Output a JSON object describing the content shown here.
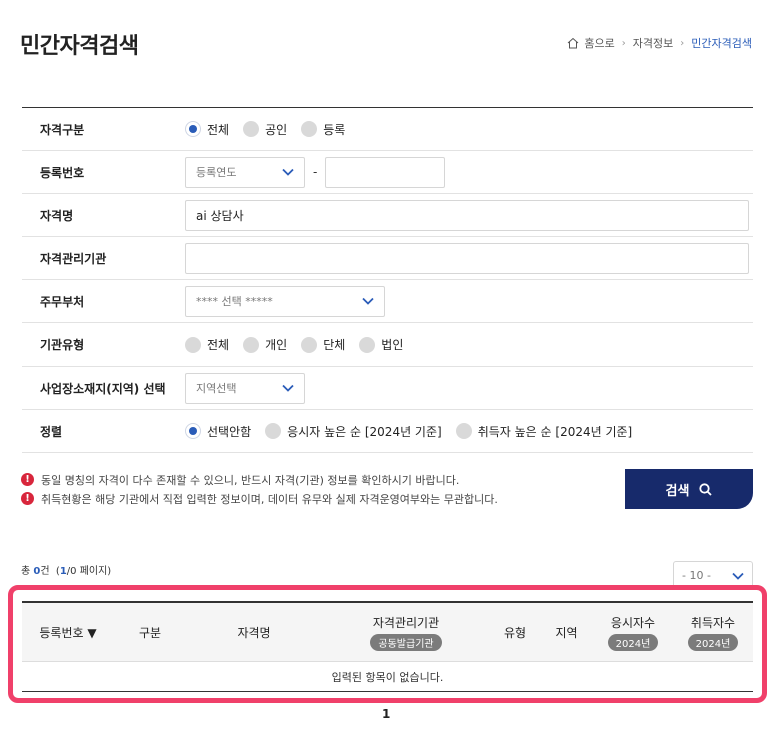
{
  "page": {
    "title": "민간자격검색"
  },
  "breadcrumb": {
    "home": "홈으로",
    "level1": "자격정보",
    "current": "민간자격검색"
  },
  "form": {
    "type": {
      "label": "자격구분",
      "options": [
        "전체",
        "공인",
        "등록"
      ],
      "selected": "전체"
    },
    "reg_no": {
      "label": "등록번호",
      "year_placeholder": "등록연도",
      "dash": "-",
      "number_value": ""
    },
    "name": {
      "label": "자격명",
      "value": "ai 상담사"
    },
    "agency": {
      "label": "자격관리기관",
      "value": ""
    },
    "ministry": {
      "label": "주무부처",
      "selected": "**** 선택 *****"
    },
    "org_type": {
      "label": "기관유형",
      "options": [
        "전체",
        "개인",
        "단체",
        "법인"
      ],
      "selected": ""
    },
    "region": {
      "label": "사업장소재지(지역) 선택",
      "selected": "지역선택"
    },
    "sort": {
      "label": "정렬",
      "options": [
        "선택안함",
        "응시자 높은 순 [2024년 기준]",
        "취득자 높은 순 [2024년 기준]"
      ],
      "selected": "선택안함"
    }
  },
  "notes": [
    "동일 명칭의 자격이 다수 존재할 수 있으니, 반드시 자격(기관) 정보를 확인하시기 바랍니다.",
    "취득현황은 해당 기관에서 직접 입력한 정보이며, 데이터 유무와 실제 자격운영여부와는 무관합니다."
  ],
  "search_button": {
    "label": "검색"
  },
  "result_summary": {
    "prefix": "총 ",
    "count": "0",
    "suffix": "건",
    "open": "(",
    "page": "1",
    "rest": "/0 페이지)"
  },
  "page_size": {
    "selected": "- 10 -"
  },
  "table": {
    "headers": {
      "reg_no": "등록번호 ▼",
      "type": "구분",
      "name": "자격명",
      "agency": "자격관리기관",
      "agency_badge": "공동발급기관",
      "org_type": "유형",
      "region": "지역",
      "applicants": "응시자수",
      "applicants_badge": "2024년",
      "acquirers": "취득자수",
      "acquirers_badge": "2024년"
    },
    "empty_message": "입력된 항목이 없습니다."
  },
  "pagination": {
    "current": "1"
  },
  "colors": {
    "accent": "#2a5cb8",
    "button": "#172a6b",
    "highlight": "#f0406a",
    "alert": "#d8263c"
  }
}
